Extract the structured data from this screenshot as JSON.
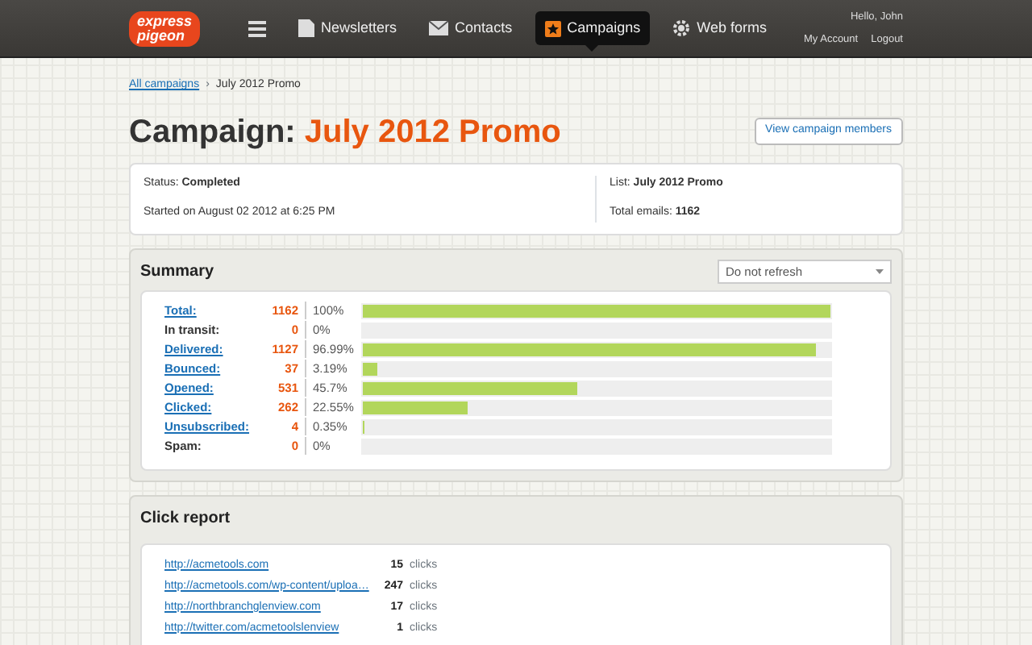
{
  "logo": {
    "line_1": "express",
    "line_2": "pigeon"
  },
  "nav": [
    {
      "kind": "menu",
      "selected": false
    },
    {
      "kind": "document",
      "label": "Newsletters",
      "selected": false
    },
    {
      "kind": "envelope",
      "label": "Contacts",
      "selected": false
    },
    {
      "kind": "star",
      "label": "Campaigns",
      "selected": true
    },
    {
      "kind": "gear",
      "label": "Web forms",
      "selected": false
    }
  ],
  "user": {
    "greeting": "Hello, John",
    "account_link": "My Account",
    "logout_link": "Logout"
  },
  "breadcrumb": {
    "link": "All campaigns",
    "separator": "›",
    "current": "July 2012 Promo"
  },
  "title": {
    "prefix": "Campaign:",
    "name": "July 2012 Promo"
  },
  "members_button": "View campaign members",
  "info": {
    "status_label": "Status:",
    "status": "Completed",
    "started": "Started on August 02 2012 at 6:25 PM",
    "list_label": "List:",
    "list": "July 2012 Promo",
    "total_label": "Total emails:",
    "total": "1162"
  },
  "summary": {
    "title": "Summary",
    "refresh": "Do not refresh",
    "rows": [
      {
        "kind": "link",
        "label": "Total:",
        "count": "1162",
        "percent": "100%",
        "level": 1
      },
      {
        "kind": "plain",
        "label": "In transit:",
        "count": "0",
        "percent": "0%",
        "level": 0
      },
      {
        "kind": "link",
        "label": "Delivered:",
        "count": "1127",
        "percent": "96.99%",
        "level": 0.9699
      },
      {
        "kind": "link",
        "label": "Bounced:",
        "count": "37",
        "percent": "3.19%",
        "level": 0.0319
      },
      {
        "kind": "link",
        "label": "Opened:",
        "count": "531",
        "percent": "45.7%",
        "level": 0.457
      },
      {
        "kind": "link",
        "label": "Clicked:",
        "count": "262",
        "percent": "22.55%",
        "level": 0.2255
      },
      {
        "kind": "link",
        "label": "Unsubscribed:",
        "count": "4",
        "percent": "0.35%",
        "level": 0.0035
      },
      {
        "kind": "plain",
        "label": "Spam:",
        "count": "0",
        "percent": "0%",
        "level": 0
      }
    ]
  },
  "click_report": {
    "title": "Click report",
    "rows": [
      {
        "url": "http://acmetools.com",
        "count": "15",
        "unit": "clicks"
      },
      {
        "url": "http://acmetools.com/wp-content/uploa…",
        "count": "247",
        "unit": "clicks"
      },
      {
        "url": "http://northbranchglenview.com",
        "count": "17",
        "unit": "clicks"
      },
      {
        "url": "http://twitter.com/acmetoolslenview",
        "count": "1",
        "unit": "clicks"
      }
    ]
  }
}
